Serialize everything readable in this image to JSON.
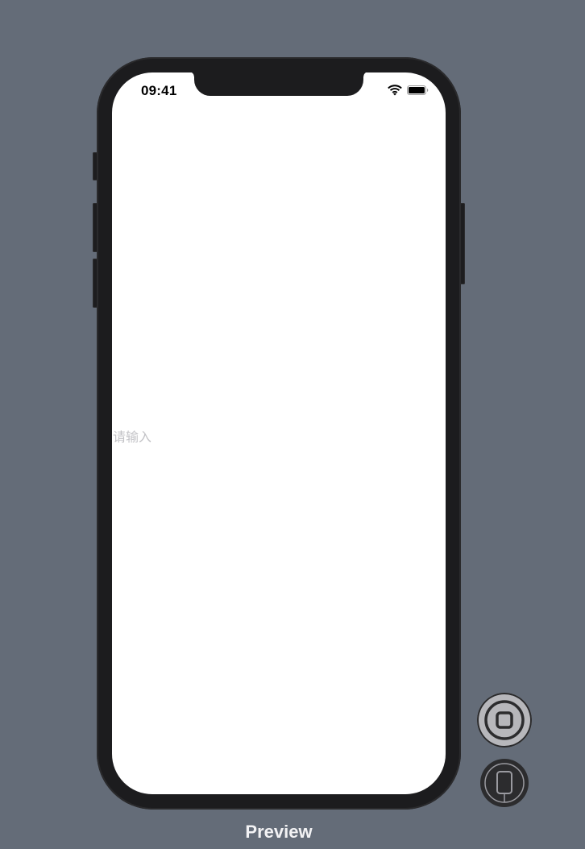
{
  "status_bar": {
    "time": "09:41",
    "wifi_icon": "wifi-icon",
    "battery_icon": "battery-full-icon"
  },
  "screen": {
    "input_placeholder": "请输入",
    "input_value": ""
  },
  "preview_controls": {
    "live_button_icon": "live-preview-icon",
    "device_button_icon": "device-settings-icon"
  },
  "footer": {
    "label": "Preview"
  },
  "colors": {
    "canvas_background": "#646c78",
    "device_bezel": "#1c1c1e",
    "screen_background": "#ffffff",
    "placeholder_text": "#c2c2c6"
  }
}
